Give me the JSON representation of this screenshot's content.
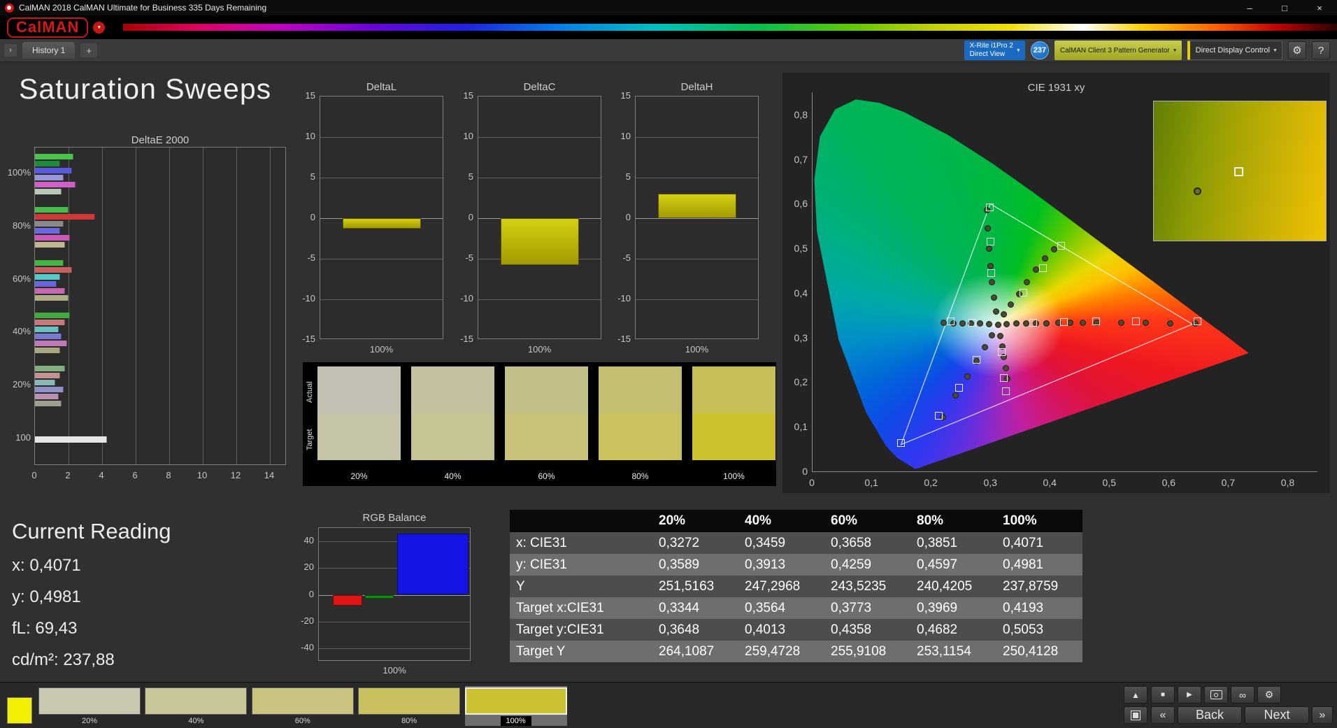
{
  "window": {
    "title": "CalMAN 2018 CalMAN Ultimate for Business 335 Days Remaining",
    "controls": {
      "minimize": "–",
      "maximize": "□",
      "close": "×"
    }
  },
  "brand": {
    "logo_text": "CalMAN"
  },
  "icons": {
    "dropdown_caret": "▼",
    "collapse": "›",
    "gear": "⚙",
    "help": "?",
    "eject": "▲",
    "stop": "■",
    "play": "▶",
    "infinity": "∞",
    "back_chevron": "«",
    "next_chevron": "»"
  },
  "toolbar": {
    "history_tab": "History 1",
    "add_tab": "+",
    "meter": {
      "line1": "X-Rite i1Pro 2",
      "line2": "Direct View"
    },
    "badge": "237",
    "pattern_generator": "CalMAN Client 3 Pattern Generator",
    "display_control": "Direct Display Control"
  },
  "page_title": "Saturation Sweeps",
  "chart_data": [
    {
      "id": "deltae2000",
      "type": "bar",
      "orientation": "horizontal",
      "title": "DeltaE 2000",
      "xlim": [
        0,
        15
      ],
      "x_ticks": [
        0,
        2,
        4,
        6,
        8,
        10,
        12,
        14
      ],
      "groups": [
        {
          "label": "100%",
          "values": [
            2.3,
            1.5,
            2.2,
            1.7,
            2.4,
            1.6
          ],
          "colors": [
            "#4cc44c",
            "#1f8a3c",
            "#5a5ae0",
            "#9898d8",
            "#d060c8",
            "#b8c8b8"
          ]
        },
        {
          "label": "80%",
          "values": [
            2.0,
            3.6,
            1.7,
            1.5,
            2.1,
            1.8
          ],
          "colors": [
            "#48bc48",
            "#d03838",
            "#8a8a8a",
            "#6a6ae0",
            "#cc58b8",
            "#c0b890"
          ]
        },
        {
          "label": "60%",
          "values": [
            1.7,
            2.2,
            1.5,
            1.3,
            1.8,
            2.0
          ],
          "colors": [
            "#44b444",
            "#c86060",
            "#58c8c8",
            "#6868d8",
            "#c868b0",
            "#b0b088"
          ]
        },
        {
          "label": "40%",
          "values": [
            2.1,
            1.8,
            1.4,
            1.6,
            1.9,
            1.5
          ],
          "colors": [
            "#40ac40",
            "#c87878",
            "#68c0c0",
            "#7878d0",
            "#c078b8",
            "#a8a880"
          ]
        },
        {
          "label": "20%",
          "values": [
            1.8,
            1.5,
            1.2,
            1.7,
            1.4,
            1.6
          ],
          "colors": [
            "#80b080",
            "#c89090",
            "#88b8b8",
            "#9090c8",
            "#b890b0",
            "#a0a090"
          ]
        },
        {
          "label": "100",
          "values": [
            4.3
          ],
          "colors": [
            "#e6e6e6"
          ]
        }
      ]
    },
    {
      "id": "deltaL",
      "type": "bar",
      "title": "DeltaL",
      "ylim": [
        -15,
        15
      ],
      "y_ticks": [
        15,
        10,
        5,
        0,
        -5,
        -10,
        -15
      ],
      "x_label": "100%",
      "bars": [
        {
          "value": -1.3,
          "color": "#b8b200"
        }
      ]
    },
    {
      "id": "deltaC",
      "type": "bar",
      "title": "DeltaC",
      "ylim": [
        -15,
        15
      ],
      "y_ticks": [
        15,
        10,
        5,
        0,
        -5,
        -10,
        -15
      ],
      "x_label": "100%",
      "bars": [
        {
          "value": -5.8,
          "color": "#b8b200"
        }
      ]
    },
    {
      "id": "deltaH",
      "type": "bar",
      "title": "DeltaH",
      "ylim": [
        -15,
        15
      ],
      "y_ticks": [
        15,
        10,
        5,
        0,
        -5,
        -10,
        -15
      ],
      "x_label": "100%",
      "bars": [
        {
          "value": 3.0,
          "color": "#b8b200"
        }
      ]
    },
    {
      "id": "rgb_balance",
      "type": "bar",
      "title": "RGB Balance",
      "ylim": [
        -50,
        50
      ],
      "y_ticks": [
        40,
        20,
        0,
        -20,
        -40
      ],
      "x_label": "100%",
      "bars": [
        {
          "name": "red",
          "value": -8,
          "color": "#e01616"
        },
        {
          "name": "green",
          "value": -3,
          "color": "#0d8f0d"
        },
        {
          "name": "blue",
          "value": 46,
          "color": "#1414e6"
        }
      ]
    },
    {
      "id": "cie1931",
      "type": "scatter",
      "title": "CIE 1931 xy",
      "xlim": [
        0,
        0.85
      ],
      "ylim": [
        0,
        0.85
      ],
      "x_ticks": [
        "0",
        "0,1",
        "0,2",
        "0,3",
        "0,4",
        "0,5",
        "0,6",
        "0,7",
        "0,8"
      ],
      "y_ticks": [
        "0,8",
        "0,7",
        "0,6",
        "0,5",
        "0,4",
        "0,3",
        "0,2",
        "0,1",
        "0"
      ],
      "gamut_triangle": [
        [
          0.64,
          0.33
        ],
        [
          0.3,
          0.6
        ],
        [
          0.15,
          0.06
        ]
      ],
      "measured": [
        [
          0.313,
          0.329
        ],
        [
          0.298,
          0.33
        ],
        [
          0.283,
          0.331
        ],
        [
          0.268,
          0.331
        ],
        [
          0.253,
          0.332
        ],
        [
          0.238,
          0.332
        ],
        [
          0.222,
          0.333
        ],
        [
          0.328,
          0.33
        ],
        [
          0.344,
          0.331
        ],
        [
          0.36,
          0.331
        ],
        [
          0.377,
          0.332
        ],
        [
          0.395,
          0.332
        ],
        [
          0.414,
          0.333
        ],
        [
          0.434,
          0.333
        ],
        [
          0.456,
          0.333
        ],
        [
          0.479,
          0.334
        ],
        [
          0.52,
          0.334
        ],
        [
          0.561,
          0.333
        ],
        [
          0.603,
          0.332
        ],
        [
          0.645,
          0.331
        ],
        [
          0.31,
          0.358
        ],
        [
          0.306,
          0.39
        ],
        [
          0.303,
          0.424
        ],
        [
          0.3,
          0.46
        ],
        [
          0.298,
          0.5
        ],
        [
          0.296,
          0.545
        ],
        [
          0.295,
          0.585
        ],
        [
          0.303,
          0.305
        ],
        [
          0.291,
          0.278
        ],
        [
          0.277,
          0.247
        ],
        [
          0.261,
          0.212
        ],
        [
          0.242,
          0.17
        ],
        [
          0.22,
          0.122
        ],
        [
          0.317,
          0.303
        ],
        [
          0.32,
          0.28
        ],
        [
          0.323,
          0.256
        ],
        [
          0.326,
          0.232
        ],
        [
          0.329,
          0.208
        ],
        [
          0.323,
          0.352
        ],
        [
          0.335,
          0.374
        ],
        [
          0.348,
          0.398
        ],
        [
          0.362,
          0.424
        ],
        [
          0.377,
          0.452
        ],
        [
          0.392,
          0.478
        ],
        [
          0.407,
          0.498
        ]
      ],
      "targets": [
        [
          0.27,
          0.334
        ],
        [
          0.233,
          0.336
        ],
        [
          0.372,
          0.334
        ],
        [
          0.424,
          0.335
        ],
        [
          0.478,
          0.336
        ],
        [
          0.545,
          0.336
        ],
        [
          0.648,
          0.336
        ],
        [
          0.301,
          0.445
        ],
        [
          0.3,
          0.515
        ],
        [
          0.299,
          0.592
        ],
        [
          0.277,
          0.25
        ],
        [
          0.248,
          0.188
        ],
        [
          0.213,
          0.124
        ],
        [
          0.15,
          0.064
        ],
        [
          0.319,
          0.268
        ],
        [
          0.323,
          0.21
        ],
        [
          0.326,
          0.18
        ],
        [
          0.356,
          0.4
        ],
        [
          0.388,
          0.456
        ],
        [
          0.419,
          0.505
        ]
      ],
      "inset": {
        "points": [
          {
            "type": "circle",
            "x_pct": 25,
            "y_pct": 64
          },
          {
            "type": "square",
            "x_pct": 49,
            "y_pct": 50
          }
        ]
      }
    }
  ],
  "saturation_swatches": {
    "row_labels": [
      "Actual",
      "Target"
    ],
    "items": [
      {
        "label": "20%",
        "actual": "#c2c1b4",
        "target": "#c6c5a9"
      },
      {
        "label": "40%",
        "actual": "#c3c19f",
        "target": "#c7c494"
      },
      {
        "label": "60%",
        "actual": "#c3bf89",
        "target": "#c8c379"
      },
      {
        "label": "80%",
        "actual": "#c4bf70",
        "target": "#cac25c"
      },
      {
        "label": "100%",
        "actual": "#c6bf55",
        "target": "#cdc22e"
      }
    ]
  },
  "current_reading": {
    "title": "Current Reading",
    "items": [
      {
        "label": "x:",
        "value": "0,4071"
      },
      {
        "label": "y:",
        "value": "0,4981"
      },
      {
        "label": "fL:",
        "value": "69,43"
      },
      {
        "label": "cd/m²:",
        "value": "237,88"
      }
    ]
  },
  "results_table": {
    "columns": [
      "",
      "20%",
      "40%",
      "60%",
      "80%",
      "100%"
    ],
    "rows": [
      {
        "label": "x: CIE31",
        "values": [
          "0,3272",
          "0,3459",
          "0,3658",
          "0,3851",
          "0,4071"
        ]
      },
      {
        "label": "y: CIE31",
        "values": [
          "0,3589",
          "0,3913",
          "0,4259",
          "0,4597",
          "0,4981"
        ]
      },
      {
        "label": "Y",
        "values": [
          "251,5163",
          "247,2968",
          "243,5235",
          "240,4205",
          "237,8759"
        ]
      },
      {
        "label": "Target x:CIE31",
        "values": [
          "0,3344",
          "0,3564",
          "0,3773",
          "0,3969",
          "0,4193"
        ]
      },
      {
        "label": "Target y:CIE31",
        "values": [
          "0,3648",
          "0,4013",
          "0,4358",
          "0,4682",
          "0,5053"
        ]
      },
      {
        "label": "Target Y",
        "values": [
          "264,1087",
          "259,4728",
          "255,9108",
          "253,1154",
          "250,4128"
        ]
      }
    ]
  },
  "bottom_bar": {
    "current_patch_color": "#f2ef00",
    "patches": [
      {
        "label": "20%",
        "color": "#c9c8b0",
        "selected": false
      },
      {
        "label": "40%",
        "color": "#c9c69a",
        "selected": false
      },
      {
        "label": "60%",
        "color": "#c9c480",
        "selected": false
      },
      {
        "label": "80%",
        "color": "#c9c160",
        "selected": false
      },
      {
        "label": "100%",
        "color": "#cbc232",
        "selected": true
      }
    ],
    "transport": {
      "back": "Back",
      "next": "Next"
    }
  }
}
